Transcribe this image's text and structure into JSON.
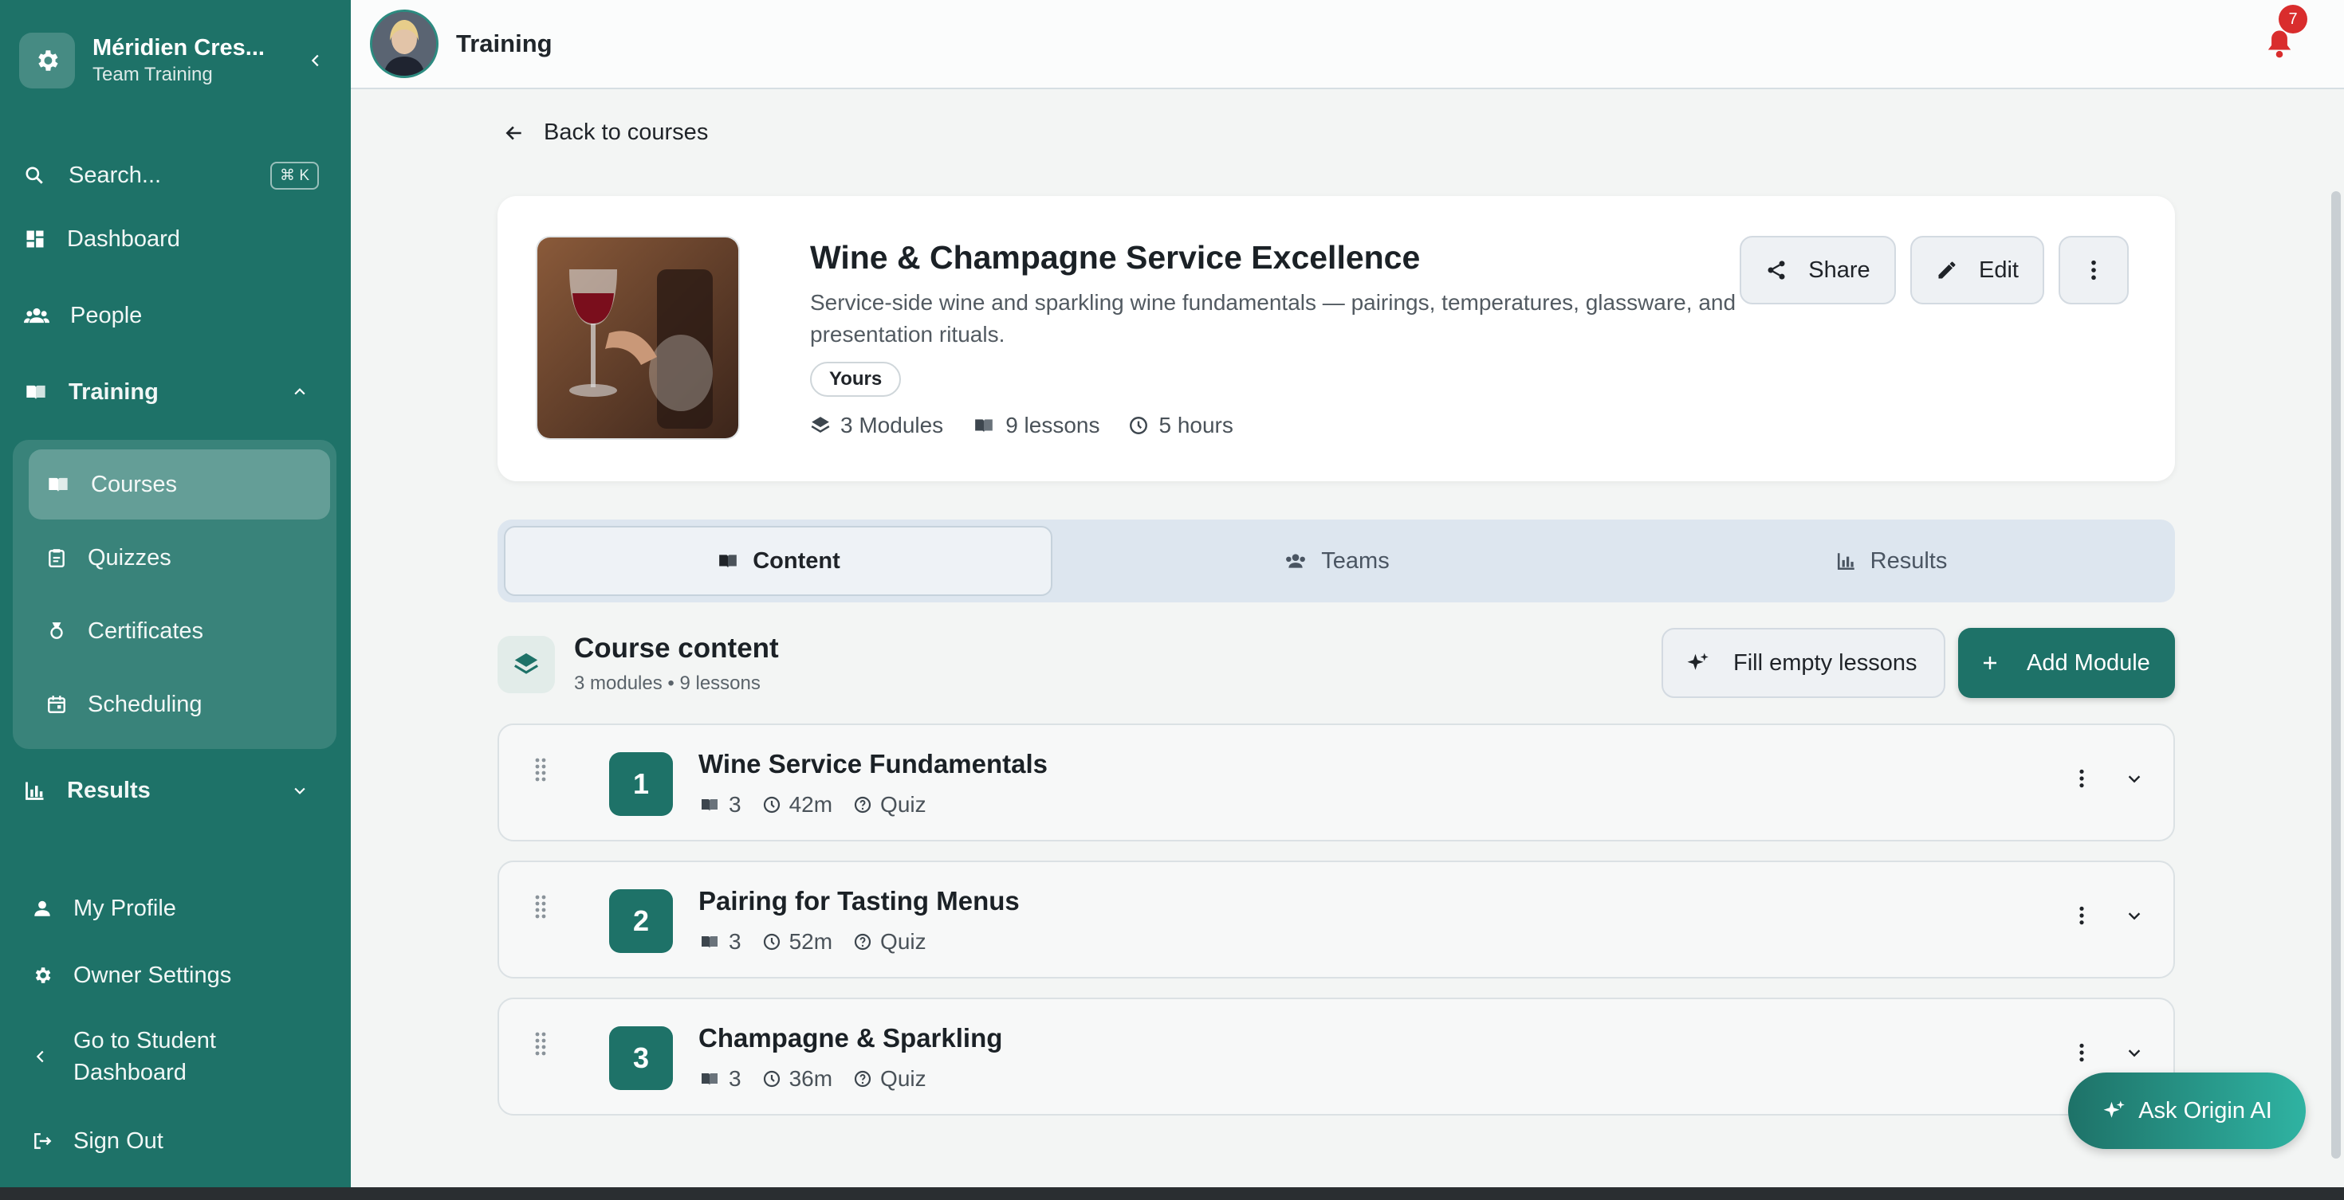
{
  "sidebar": {
    "org_name": "Méridien Cres...",
    "org_sub": "Team Training",
    "search_label": "Search...",
    "search_shortcut": "⌘ K",
    "items": {
      "dashboard": "Dashboard",
      "people": "People",
      "training": "Training",
      "courses": "Courses",
      "quizzes": "Quizzes",
      "certificates": "Certificates",
      "scheduling": "Scheduling",
      "results": "Results"
    },
    "bottom": {
      "my_profile": "My Profile",
      "owner_settings": "Owner Settings",
      "student_dashboard_line1": "Go to Student",
      "student_dashboard_line2": "Dashboard",
      "sign_out": "Sign Out"
    }
  },
  "topbar": {
    "title": "Training",
    "notifications": "7"
  },
  "back_label": "Back to courses",
  "course": {
    "title": "Wine & Champagne Service Excellence",
    "description": "Service-side wine and sparkling wine fundamentals — pairings, temperatures, glassware, and presentation rituals.",
    "badge": "Yours",
    "modules": "3 Modules",
    "lessons": "9 lessons",
    "duration": "5 hours",
    "share_label": "Share",
    "edit_label": "Edit"
  },
  "tabs": {
    "content": "Content",
    "teams": "Teams",
    "results": "Results"
  },
  "content_section": {
    "title": "Course content",
    "subtitle": "3 modules • 9 lessons",
    "fill_label": "Fill empty lessons",
    "add_label": "Add Module"
  },
  "modules": [
    {
      "num": "1",
      "title": "Wine Service Fundamentals",
      "lessons": "3",
      "duration": "42m",
      "quiz": "Quiz"
    },
    {
      "num": "2",
      "title": "Pairing for Tasting Menus",
      "lessons": "3",
      "duration": "52m",
      "quiz": "Quiz"
    },
    {
      "num": "3",
      "title": "Champagne & Sparkling",
      "lessons": "3",
      "duration": "36m",
      "quiz": "Quiz"
    }
  ],
  "ask_ai_label": "Ask Origin AI",
  "colors": {
    "sidebar": "#1e7268",
    "accent": "#1e7268",
    "badge": "#d92d2d"
  }
}
